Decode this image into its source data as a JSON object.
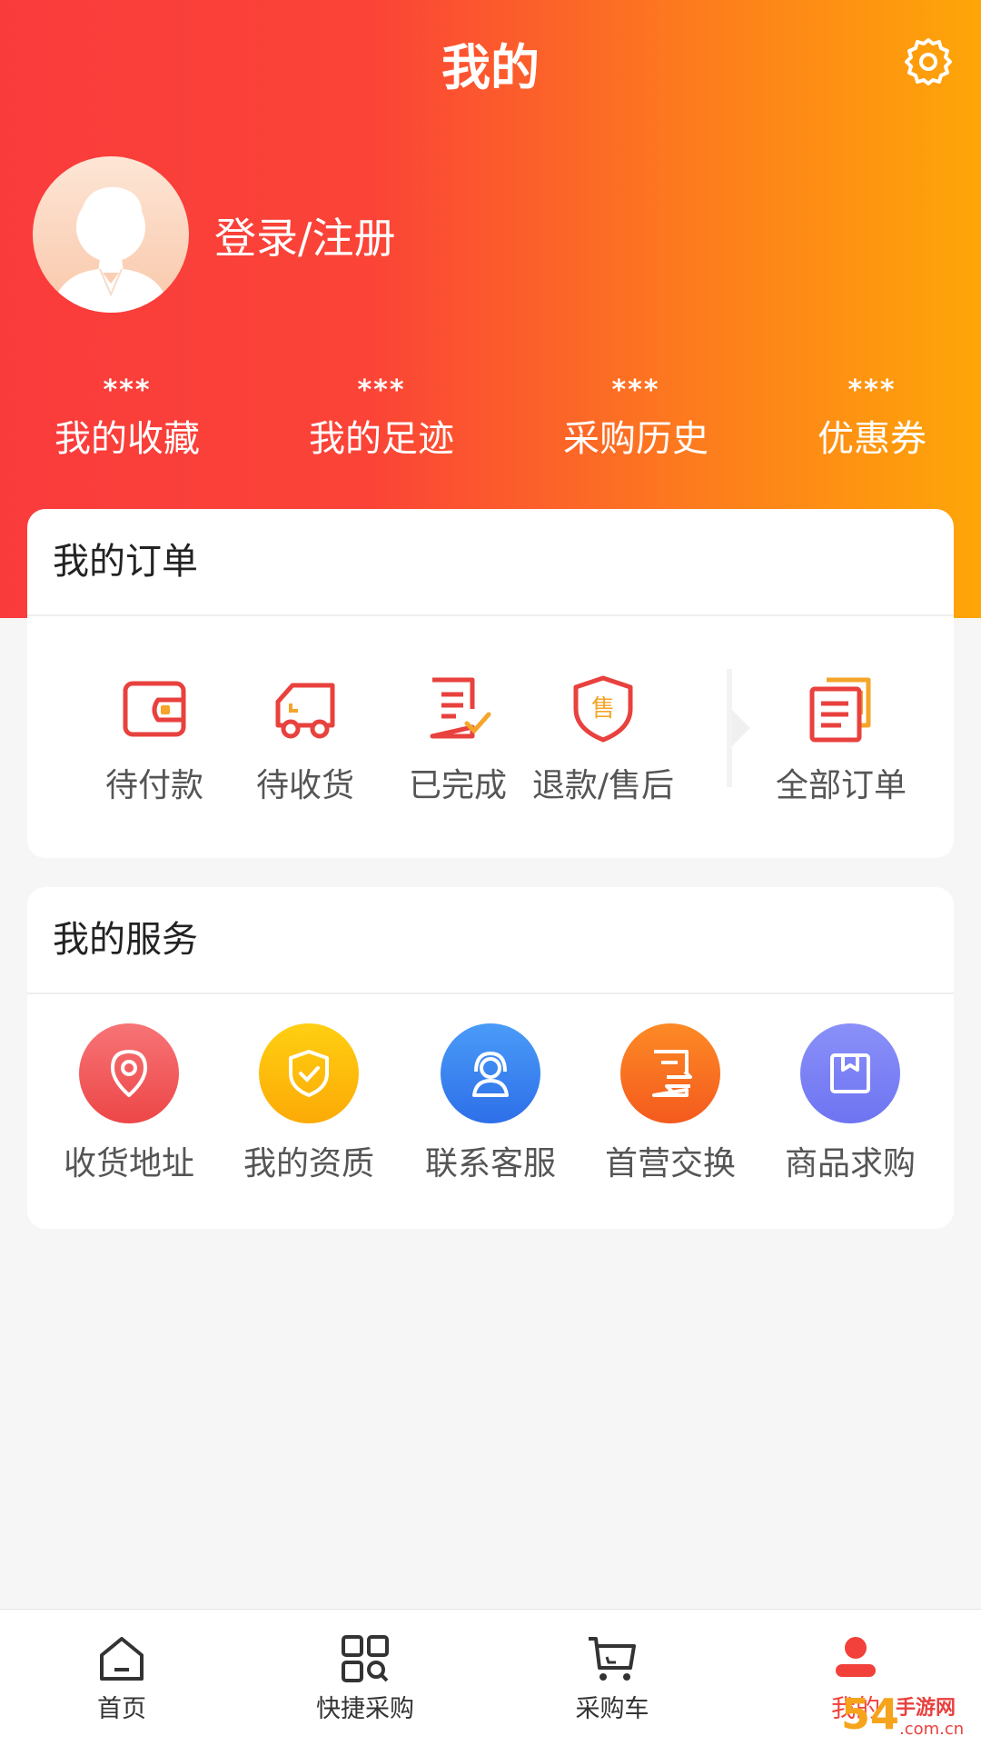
{
  "header": {
    "title": "我的",
    "settings_icon": "gear-icon",
    "login_label": "登录/注册",
    "gradient": [
      "#fa3b3c",
      "#fea608"
    ]
  },
  "stats": [
    {
      "value": "***",
      "label": "我的收藏"
    },
    {
      "value": "***",
      "label": "我的足迹"
    },
    {
      "value": "***",
      "label": "采购历史"
    },
    {
      "value": "***",
      "label": "优惠券"
    }
  ],
  "orders": {
    "title": "我的订单",
    "items": [
      {
        "label": "待付款",
        "icon": "wallet-icon"
      },
      {
        "label": "待收货",
        "icon": "truck-icon"
      },
      {
        "label": "已完成",
        "icon": "completed-doc-icon"
      },
      {
        "label": "退款/售后",
        "icon": "after-sale-shield-icon"
      },
      {
        "label": "全部订单",
        "icon": "all-orders-icon"
      }
    ]
  },
  "services": {
    "title": "我的服务",
    "items": [
      {
        "label": "收货地址",
        "icon": "location-pin-icon",
        "color": "#f25e60"
      },
      {
        "label": "我的资质",
        "icon": "shield-check-icon",
        "color": "#fdba08"
      },
      {
        "label": "联系客服",
        "icon": "customer-service-icon",
        "color": "#3a86f3"
      },
      {
        "label": "首营交换",
        "icon": "exchange-doc-icon",
        "color": "#fb6f22"
      },
      {
        "label": "商品求购",
        "icon": "box-icon",
        "color": "#7f86f6"
      }
    ]
  },
  "tabbar": {
    "items": [
      {
        "label": "首页",
        "icon": "home-icon"
      },
      {
        "label": "快捷采购",
        "icon": "qr-scan-icon"
      },
      {
        "label": "采购车",
        "icon": "cart-icon"
      },
      {
        "label": "我的",
        "icon": "user-icon"
      }
    ],
    "active_color": "#f2403a"
  },
  "watermark": {
    "text": "54岁手游网 .com.cn"
  }
}
